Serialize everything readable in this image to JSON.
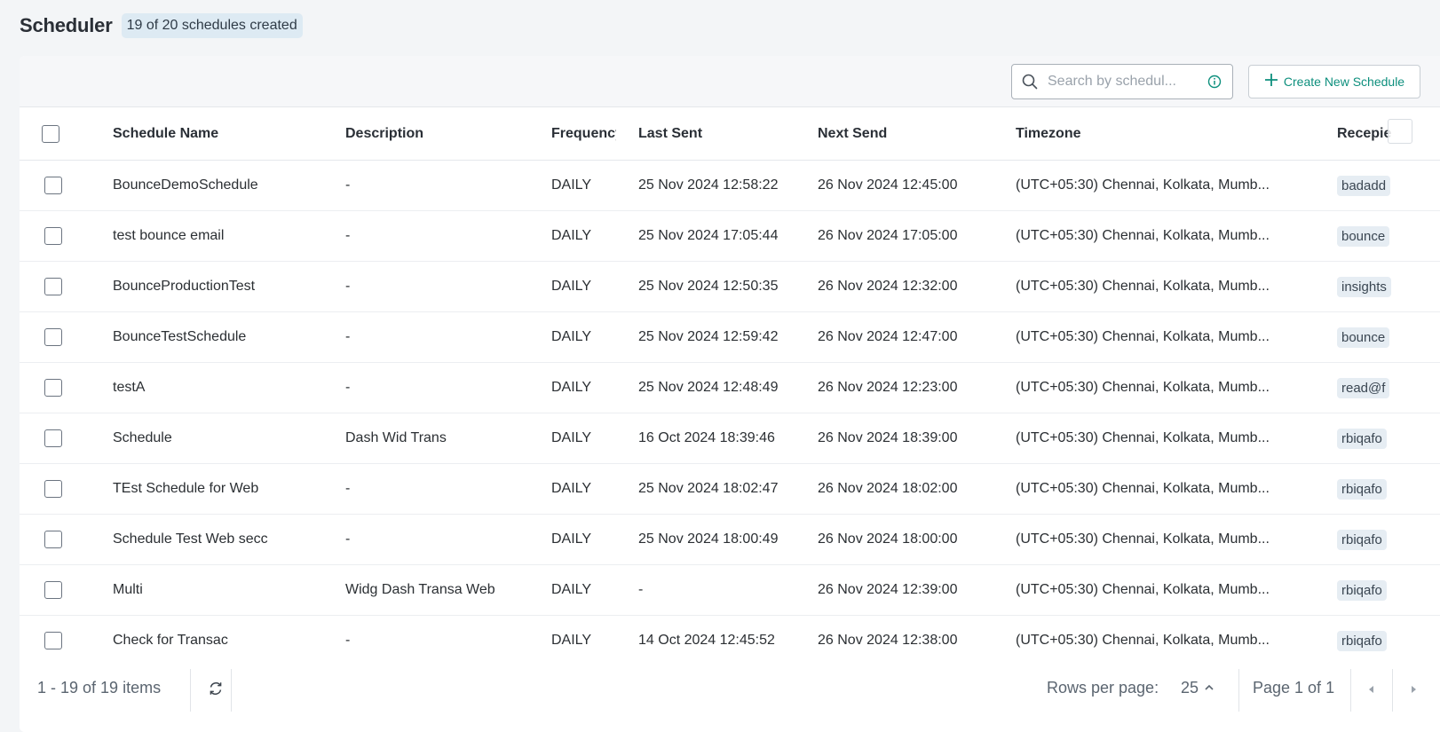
{
  "header": {
    "title": "Scheduler",
    "count_badge": "19 of 20 schedules created"
  },
  "toolbar": {
    "search_placeholder": "Search by schedul...",
    "create_label": "Create New Schedule"
  },
  "table": {
    "columns": [
      "Schedule Name",
      "Description",
      "Frequency",
      "Last Sent",
      "Next Send",
      "Timezone",
      "Recepie"
    ],
    "rows": [
      {
        "name": "BounceDemoSchedule",
        "description": "-",
        "frequency": "DAILY",
        "last_sent": "25 Nov 2024 12:58:22",
        "next_send": "26 Nov 2024 12:45:00",
        "timezone": "(UTC+05:30) Chennai, Kolkata, Mumb...",
        "recipient": "badadd"
      },
      {
        "name": "test bounce email",
        "description": "-",
        "frequency": "DAILY",
        "last_sent": "25 Nov 2024 17:05:44",
        "next_send": "26 Nov 2024 17:05:00",
        "timezone": "(UTC+05:30) Chennai, Kolkata, Mumb...",
        "recipient": "bounce"
      },
      {
        "name": "BounceProductionTest",
        "description": "-",
        "frequency": "DAILY",
        "last_sent": "25 Nov 2024 12:50:35",
        "next_send": "26 Nov 2024 12:32:00",
        "timezone": "(UTC+05:30) Chennai, Kolkata, Mumb...",
        "recipient": "insights"
      },
      {
        "name": "BounceTestSchedule",
        "description": "-",
        "frequency": "DAILY",
        "last_sent": "25 Nov 2024 12:59:42",
        "next_send": "26 Nov 2024 12:47:00",
        "timezone": "(UTC+05:30) Chennai, Kolkata, Mumb...",
        "recipient": "bounce"
      },
      {
        "name": "testA",
        "description": "-",
        "frequency": "DAILY",
        "last_sent": "25 Nov 2024 12:48:49",
        "next_send": "26 Nov 2024 12:23:00",
        "timezone": "(UTC+05:30) Chennai, Kolkata, Mumb...",
        "recipient": "read@f"
      },
      {
        "name": "Schedule",
        "description": "Dash Wid Trans",
        "frequency": "DAILY",
        "last_sent": "16 Oct 2024 18:39:46",
        "next_send": "26 Nov 2024 18:39:00",
        "timezone": "(UTC+05:30) Chennai, Kolkata, Mumb...",
        "recipient": "rbiqafo"
      },
      {
        "name": "TEst Schedule for Web",
        "description": "-",
        "frequency": "DAILY",
        "last_sent": "25 Nov 2024 18:02:47",
        "next_send": "26 Nov 2024 18:02:00",
        "timezone": "(UTC+05:30) Chennai, Kolkata, Mumb...",
        "recipient": "rbiqafo"
      },
      {
        "name": "Schedule Test Web secc",
        "description": "-",
        "frequency": "DAILY",
        "last_sent": "25 Nov 2024 18:00:49",
        "next_send": "26 Nov 2024 18:00:00",
        "timezone": "(UTC+05:30) Chennai, Kolkata, Mumb...",
        "recipient": "rbiqafo"
      },
      {
        "name": "Multi",
        "description": "Widg Dash Transa Web",
        "frequency": "DAILY",
        "last_sent": "-",
        "next_send": "26 Nov 2024 12:39:00",
        "timezone": "(UTC+05:30) Chennai, Kolkata, Mumb...",
        "recipient": "rbiqafo"
      },
      {
        "name": "Check for Transac",
        "description": "-",
        "frequency": "DAILY",
        "last_sent": "14 Oct 2024 12:45:52",
        "next_send": "26 Nov 2024 12:38:00",
        "timezone": "(UTC+05:30) Chennai, Kolkata, Mumb...",
        "recipient": "rbiqafo"
      }
    ]
  },
  "footer": {
    "items_text": "1 - 19 of 19 items",
    "rows_per_page_label": "Rows per page:",
    "rows_per_page_value": "25",
    "page_text": "Page 1 of 1"
  },
  "icons": {
    "search": "search-icon",
    "info": "info-icon",
    "plus": "plus-icon",
    "refresh": "refresh-icon",
    "caret": "chevron-up-icon",
    "prev": "prev-page-icon",
    "next": "next-page-icon"
  },
  "colors": {
    "accent": "#0d8f7d",
    "badge_bg": "#ddeaf3",
    "chip_bg": "#e6edf3"
  }
}
